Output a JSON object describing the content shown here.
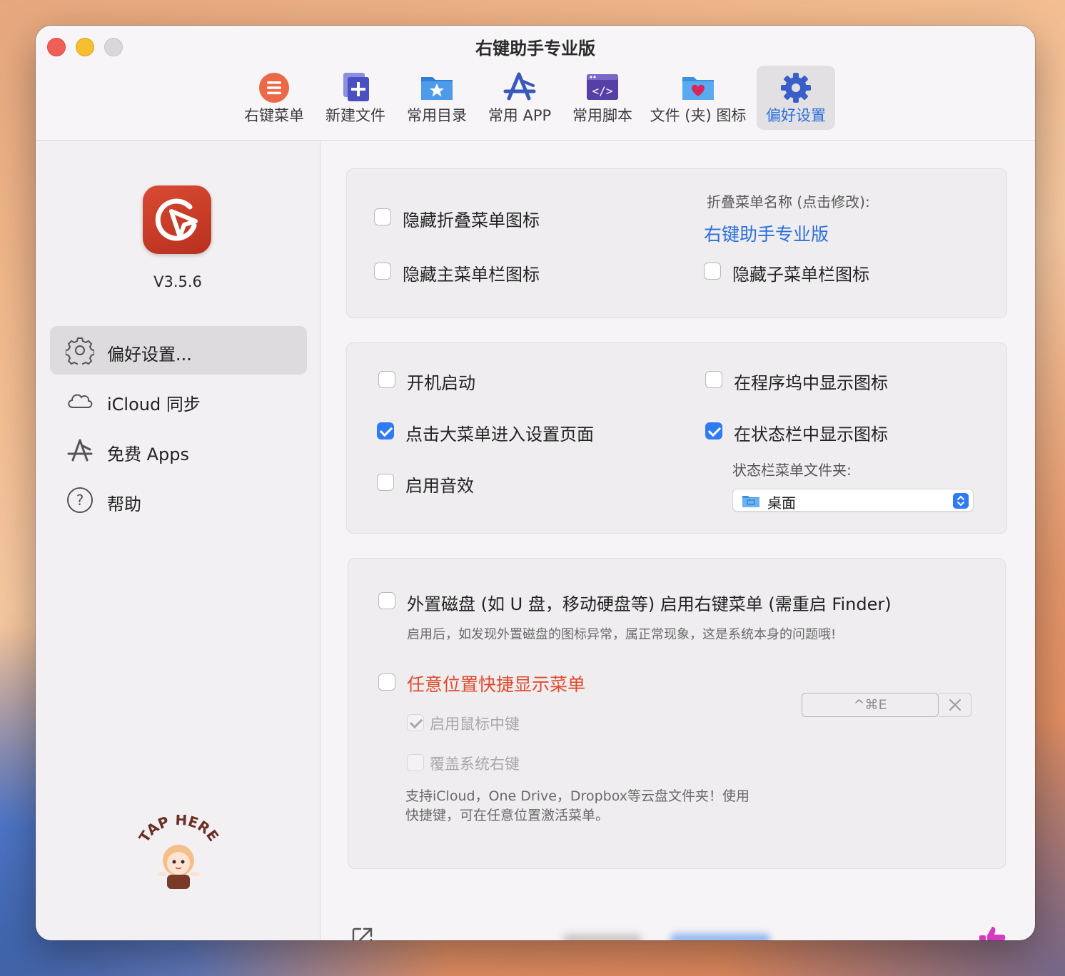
{
  "window": {
    "title": "右键助手专业版"
  },
  "toolbar": {
    "items": [
      {
        "label": "右键菜单",
        "icon": "menu-circle-icon"
      },
      {
        "label": "新建文件",
        "icon": "new-file-icon"
      },
      {
        "label": "常用目录",
        "icon": "star-folder-icon"
      },
      {
        "label": "常用 APP",
        "icon": "app-store-icon"
      },
      {
        "label": "常用脚本",
        "icon": "script-icon"
      },
      {
        "label": "文件 (夹) 图标",
        "icon": "heart-folder-icon"
      },
      {
        "label": "偏好设置",
        "icon": "gear-icon",
        "active": true
      }
    ]
  },
  "sidebar": {
    "version": "V3.5.6",
    "items": [
      {
        "label": "偏好设置...",
        "icon": "gear-icon",
        "active": true
      },
      {
        "label": "iCloud 同步",
        "icon": "cloud-icon"
      },
      {
        "label": "免费 Apps",
        "icon": "app-store-icon"
      },
      {
        "label": "帮助",
        "icon": "help-icon"
      }
    ],
    "mascot_text": "TAP HERE"
  },
  "panel1": {
    "hide_fold_icon": {
      "label": "隐藏折叠菜单图标",
      "checked": false
    },
    "hide_main_icon": {
      "label": "隐藏主菜单栏图标",
      "checked": false
    },
    "fold_name_caption": "折叠菜单名称 (点击修改):",
    "fold_name_value": "右键助手专业版",
    "hide_sub_icon": {
      "label": "隐藏子菜单栏图标",
      "checked": false
    }
  },
  "panel2": {
    "launch_at_login": {
      "label": "开机启动",
      "checked": false
    },
    "click_open_settings": {
      "label": "点击大菜单进入设置页面",
      "checked": true
    },
    "enable_sound": {
      "label": "启用音效",
      "checked": false
    },
    "show_in_dock": {
      "label": "在程序坞中显示图标",
      "checked": false
    },
    "show_in_status_bar": {
      "label": "在状态栏中显示图标",
      "checked": true
    },
    "status_folder_caption": "状态栏菜单文件夹:",
    "status_folder_value": "桌面"
  },
  "panel3": {
    "external_disk": {
      "label": "外置磁盘 (如 U 盘，移动硬盘等) 启用右键菜单 (需重启 Finder)",
      "checked": false
    },
    "external_disk_hint": "启用后，如发现外置磁盘的图标异常，属正常现象，这是系统本身的问题哦!",
    "anywhere_menu": {
      "label": "任意位置快捷显示菜单",
      "checked": false
    },
    "hotkey": "^⌘E",
    "middle_click": {
      "label": "启用鼠标中键",
      "checked": true
    },
    "override_right_click": {
      "label": "覆盖系统右键",
      "checked": false
    },
    "cloud_hint_line1": "支持iCloud，One Drive，Dropbox等云盘文件夹！使用",
    "cloud_hint_line2": "快捷键，可在任意位置激活菜单。"
  },
  "colors": {
    "accent": "#2f7bf5",
    "link": "#2a6fdc",
    "warning": "#e04a2c",
    "app_icon": "#c93a26"
  }
}
